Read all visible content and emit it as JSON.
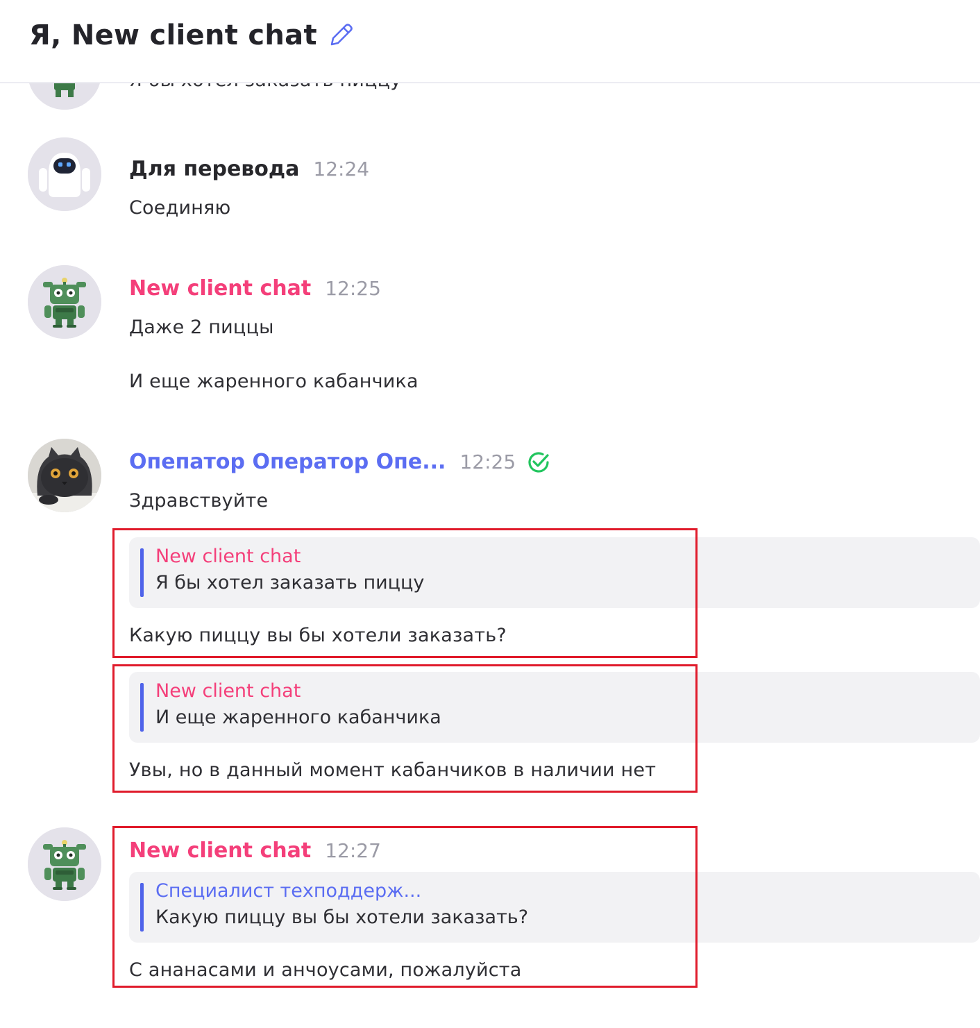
{
  "header": {
    "title": "Я, New client chat",
    "edit_icon": "pencil-icon"
  },
  "messages": [
    {
      "author": "",
      "time": "",
      "avatar": "robot-green-avatar",
      "texts": [
        "Я бы хотел заказать пиццу"
      ]
    },
    {
      "author": "Для перевода",
      "time": "12:24",
      "avatar": "bot-avatar",
      "texts": [
        "Соединяю"
      ]
    },
    {
      "author": "New client chat",
      "time": "12:25",
      "avatar": "robot-green-avatar",
      "texts": [
        "Даже 2 пиццы",
        "И еще жаренного кабанчика"
      ]
    },
    {
      "author": "Опепатор Оператор Опе...",
      "time": "12:25",
      "avatar": "cat-photo-avatar",
      "status_icon": "check-circle-icon",
      "texts": [
        "Здравствуйте"
      ],
      "replies": [
        {
          "quote_author": "New client chat",
          "quote_text": "Я бы хотел заказать пиццу",
          "text": "Какую пиццу вы бы хотели заказать?"
        },
        {
          "quote_author": "New client chat",
          "quote_text": "И еще жаренного кабанчика",
          "text": "Увы, но в данный момент кабанчиков в наличии нет"
        }
      ]
    },
    {
      "author": "New client chat",
      "time": "12:27",
      "avatar": "robot-green-avatar",
      "replies": [
        {
          "quote_author": "Специалист техподдерж...",
          "quote_text": "Какую пиццу вы бы хотели заказать?",
          "text": "С ананасами и анчоусами, пожалуйста"
        }
      ]
    }
  ],
  "colors": {
    "client": "#f43f7a",
    "operator": "#5b6df2",
    "highlight": "#e01b2b",
    "quote_bg": "#f2f2f4",
    "check": "#22c55e"
  }
}
